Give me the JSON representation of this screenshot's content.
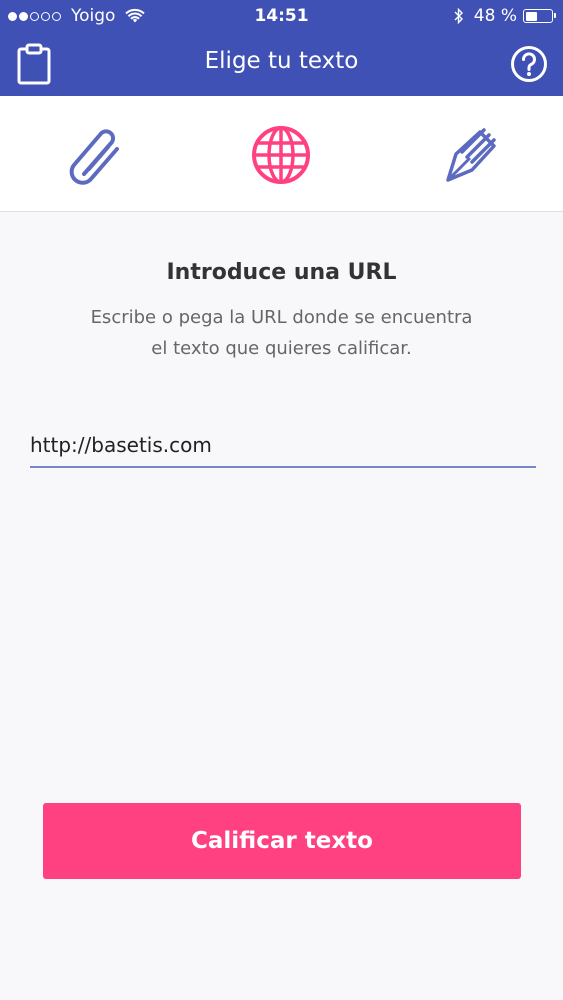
{
  "status_bar": {
    "carrier": "Yoigo",
    "time": "14:51",
    "battery_percent_label": "48 %",
    "battery_level": 0.48,
    "signal_bars_filled": 2,
    "signal_bars_total": 5,
    "icons": [
      "wifi-icon",
      "bluetooth-icon",
      "battery-icon"
    ]
  },
  "header": {
    "title": "Elige tu texto",
    "left_icon": "clipboard-icon",
    "right_icon": "help-icon"
  },
  "source_tabs": {
    "items": [
      {
        "icon": "paperclip-icon",
        "active": false
      },
      {
        "icon": "globe-icon",
        "active": true
      },
      {
        "icon": "pen-nib-icon",
        "active": false
      }
    ],
    "active_color": "#ff4081",
    "inactive_color": "#5c6bc0"
  },
  "content": {
    "title": "Introduce una URL",
    "description_line1": "Escribe o pega la URL donde se encuentra",
    "description_line2": "el texto que quieres calificar.",
    "url_value": "http://basetis.com"
  },
  "actions": {
    "submit_label": "Calificar texto"
  },
  "colors": {
    "primary": "#3f51b5",
    "accent": "#ff4081",
    "background": "#f8f8fb"
  }
}
